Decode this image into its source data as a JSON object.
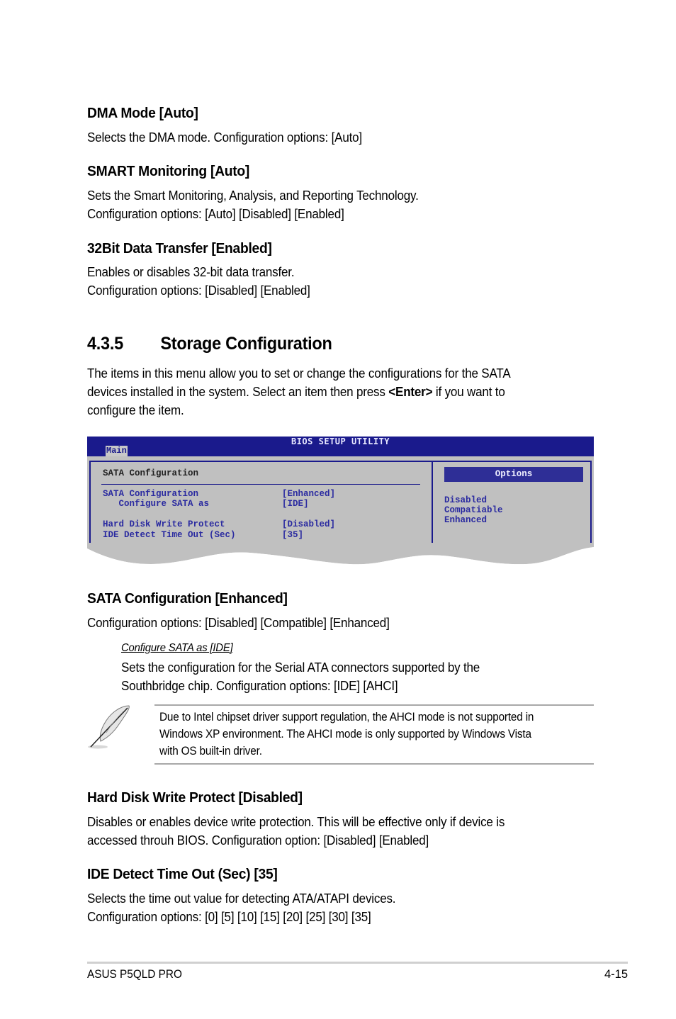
{
  "sections_top": [
    {
      "heading": "DMA Mode [Auto]",
      "lines": [
        "Selects the DMA mode. Configuration options: [Auto]"
      ]
    },
    {
      "heading": "SMART Monitoring [Auto]",
      "lines": [
        "Sets the Smart Monitoring, Analysis, and Reporting Technology.",
        "Configuration options: [Auto] [Disabled] [Enabled]"
      ]
    },
    {
      "heading": "32Bit Data Transfer [Enabled]",
      "lines": [
        "Enables or disables 32-bit data transfer.",
        "Configuration options: [Disabled] [Enabled]"
      ]
    }
  ],
  "section_435": {
    "number": "4.3.5",
    "title": "Storage Configuration",
    "intro_line1": "The items in this menu allow you to set or change the configurations for the SATA",
    "intro_line2_before": "devices installed in the system. Select an item then press ",
    "intro_line2_bold": "<Enter>",
    "intro_line2_after": " if you want to",
    "intro_line3": "configure the item."
  },
  "bios": {
    "title": "BIOS SETUP UTILITY",
    "tab": "Main",
    "panel_heading": "SATA Configuration",
    "items": [
      {
        "label": "SATA Configuration",
        "value": "[Enhanced]"
      },
      {
        "label": "   Configure SATA as",
        "value": "[IDE]"
      },
      {
        "label": "Hard Disk Write Protect",
        "value": "[Disabled]"
      },
      {
        "label": "IDE Detect Time Out (Sec)",
        "value": "[35]"
      }
    ],
    "options_heading": "Options",
    "options": [
      "Disabled",
      "Compatiable",
      "Enhanced"
    ],
    "colors": {
      "bar": "#1a1a8c",
      "panel": "#c0c0c0",
      "text": "#2a2aa0"
    }
  },
  "sata_config": {
    "heading": "SATA Configuration [Enhanced]",
    "line": "Configuration options: [Disabled] [Compatible] [Enhanced]",
    "sub_heading": "Configure SATA as [IDE]",
    "sub_lines": [
      "Sets the configuration for the Serial ATA connectors supported by the",
      "Southbridge chip. Configuration options: [IDE] [AHCI]"
    ]
  },
  "note": {
    "icon": "feather-pen-icon",
    "lines": [
      "Due to Intel chipset driver support regulation, the AHCI mode is not supported in",
      "Windows XP environment. The AHCI mode is only supported by Windows Vista",
      "with OS built-in driver."
    ]
  },
  "sections_bottom": [
    {
      "heading": "Hard Disk Write Protect [Disabled]",
      "lines": [
        "Disables or enables device write protection. This will be effective only if device is",
        "accessed throuh BIOS. Configuration option: [Disabled] [Enabled]"
      ]
    },
    {
      "heading": "IDE Detect Time Out (Sec) [35]",
      "lines": [
        "Selects the time out value for detecting ATA/ATAPI devices.",
        "Configuration options: [0] [5] [10] [15] [20] [25] [30] [35]"
      ]
    }
  ],
  "footer": {
    "product": "ASUS P5QLD PRO",
    "page": "4-15"
  }
}
